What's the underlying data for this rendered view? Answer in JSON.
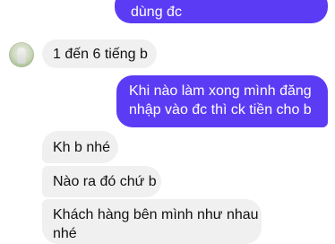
{
  "messages": [
    {
      "from": "me",
      "text": "dùng đc"
    },
    {
      "from": "them",
      "text": "1 đến 6 tiếng b"
    },
    {
      "from": "me",
      "lines": [
        "Khi nào làm xong mình đăng",
        "nhập vào đc thì ck tiền cho b"
      ]
    },
    {
      "from": "them",
      "text": "Kh b nhé"
    },
    {
      "from": "them",
      "text": "Nào ra đó chứ b"
    },
    {
      "from": "them",
      "lines": [
        "Khách hàng bên mình như nhau",
        "nhé"
      ]
    }
  ],
  "colors": {
    "outgoing_bubble": "#5b3cf4",
    "incoming_bubble": "#f0f0f0",
    "outgoing_text": "#ffffff",
    "incoming_text": "#111111"
  }
}
